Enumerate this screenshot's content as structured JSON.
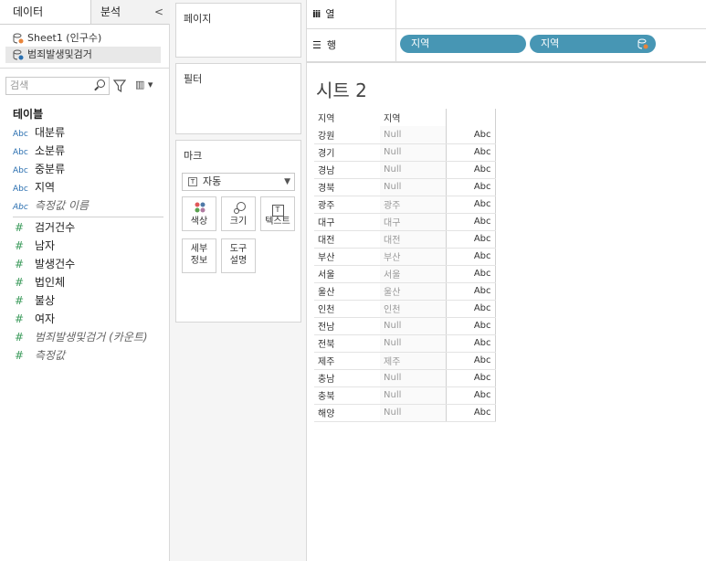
{
  "data_pane": {
    "tab_data": "데이터",
    "tab_analysis": "분석",
    "collapse": "<",
    "datasources": [
      "Sheet1 (인구수)",
      "범죄발생및검거"
    ],
    "search_placeholder": "검색",
    "section_tables": "테이블",
    "dimensions": [
      {
        "type": "Abc",
        "name": "대분류"
      },
      {
        "type": "Abc",
        "name": "소분류"
      },
      {
        "type": "Abc",
        "name": "중분류"
      },
      {
        "type": "Abc",
        "name": "지역"
      },
      {
        "type": "Abc",
        "name": "측정값 이름"
      }
    ],
    "measures": [
      {
        "type": "#",
        "name": "검거건수"
      },
      {
        "type": "#",
        "name": "남자"
      },
      {
        "type": "#",
        "name": "발생건수"
      },
      {
        "type": "#",
        "name": "법인체"
      },
      {
        "type": "#",
        "name": "불상"
      },
      {
        "type": "#",
        "name": "여자"
      },
      {
        "type": "#",
        "name": "범죄발생및검거 (카운트)"
      },
      {
        "type": "#",
        "name": "측정값"
      }
    ]
  },
  "cards": {
    "pages": "페이지",
    "filters": "필터",
    "marks": "마크",
    "mark_type": "자동",
    "mark_type_icon": "T",
    "mark_buttons": [
      {
        "sym": "●",
        "label": "색상"
      },
      {
        "sym": "○",
        "label": "크기"
      },
      {
        "sym": "T",
        "label": "텍스트"
      },
      {
        "label": "세부\n정보"
      },
      {
        "label": "도구\n설명"
      }
    ]
  },
  "shelves": {
    "columns_icon": "iii",
    "columns_label": "열",
    "rows_icon": "☰",
    "rows_label": "행",
    "row_pills": [
      "지역",
      "지역"
    ]
  },
  "view": {
    "title": "시트 2",
    "headers": [
      "지역",
      "지역",
      ""
    ],
    "rows": [
      [
        "강원",
        "Null",
        "Abc"
      ],
      [
        "경기",
        "Null",
        "Abc"
      ],
      [
        "경남",
        "Null",
        "Abc"
      ],
      [
        "경북",
        "Null",
        "Abc"
      ],
      [
        "광주",
        "광주",
        "Abc"
      ],
      [
        "대구",
        "대구",
        "Abc"
      ],
      [
        "대전",
        "대전",
        "Abc"
      ],
      [
        "부산",
        "부산",
        "Abc"
      ],
      [
        "서울",
        "서울",
        "Abc"
      ],
      [
        "울산",
        "울산",
        "Abc"
      ],
      [
        "인천",
        "인천",
        "Abc"
      ],
      [
        "전남",
        "Null",
        "Abc"
      ],
      [
        "전북",
        "Null",
        "Abc"
      ],
      [
        "제주",
        "제주",
        "Abc"
      ],
      [
        "충남",
        "Null",
        "Abc"
      ],
      [
        "충북",
        "Null",
        "Abc"
      ],
      [
        "해양",
        "Null",
        "Abc"
      ]
    ]
  },
  "colors": {
    "pill": "#4796b4",
    "measure": "#3a9a5a",
    "dimension": "#2a6fb0"
  }
}
